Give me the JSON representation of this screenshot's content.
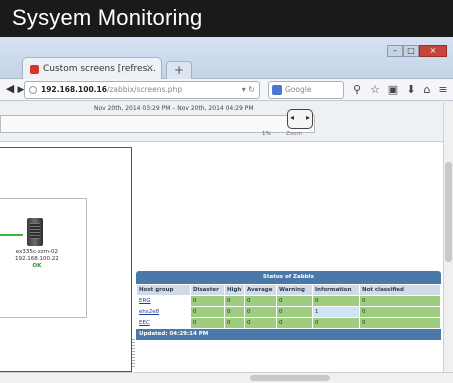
{
  "banner": {
    "title": "Sysyem Monitoring"
  },
  "browser": {
    "tab_title": "Custom screens [refres...",
    "tab_close": "×",
    "new_tab": "+",
    "window_controls": {
      "minimize": "–",
      "maximize": "□",
      "close": "×"
    },
    "url_host": "192.168.100.16",
    "url_path": "/zabbix/screens.php",
    "search_placeholder": "Google"
  },
  "screen": {
    "date_range": "Nov 20th, 2014 03:29 PM  –  Nov 20th, 2014 04:29 PM",
    "zoom_label": "Zoom",
    "percent": "1%",
    "host": {
      "name_line1": "ex335c-zzm-02",
      "name_line2": "192.168.100.22",
      "status": "OK"
    }
  },
  "zabbix_status": {
    "title": "Status of Zabbix",
    "columns": [
      "Host group",
      "Disaster",
      "High",
      "Average",
      "Warning",
      "Information",
      "Not classified"
    ],
    "rows": [
      {
        "group": "ERG",
        "values": [
          "0",
          "0",
          "0",
          "0",
          "0",
          "0"
        ]
      },
      {
        "group": "ehs2e8",
        "values": [
          "0",
          "0",
          "0",
          "0",
          "1",
          "0"
        ]
      },
      {
        "group": "EEC",
        "values": [
          "0",
          "0",
          "0",
          "0",
          "0",
          "0"
        ]
      }
    ],
    "updated": "Updated: 04:29:14 PM"
  },
  "colors": {
    "banner_bg": "#1a1a1a",
    "ok_cell": "#9ecd7f",
    "info_cell": "#cfe3f4",
    "header_blue": "#4a79a9"
  }
}
